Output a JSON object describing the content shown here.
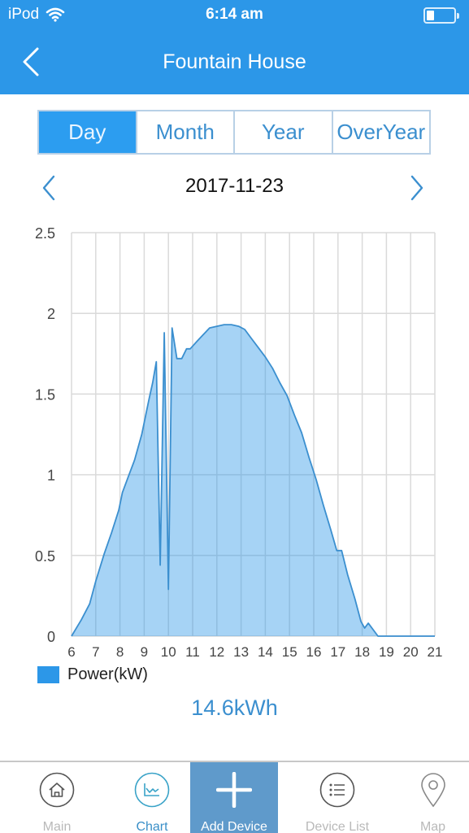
{
  "status_bar": {
    "carrier": "iPod",
    "time": "6:14 am",
    "battery_level": 0.2
  },
  "header": {
    "title": "Fountain House",
    "back_icon": "chevron-left-icon"
  },
  "period_tabs": [
    {
      "label": "Day",
      "active": true
    },
    {
      "label": "Month",
      "active": false
    },
    {
      "label": "Year",
      "active": false
    },
    {
      "label": "OverYear",
      "active": false
    }
  ],
  "date_nav": {
    "date": "2017-11-23",
    "prev_icon": "chevron-left-icon",
    "next_icon": "chevron-right-icon"
  },
  "colors": {
    "accent": "#2c97e8",
    "fill": "#a9d4f5",
    "line": "#3b8fcf",
    "add_tab": "#5f9acb"
  },
  "legend": {
    "label": "Power(kW)"
  },
  "total": {
    "label": "14.6kWh"
  },
  "chart_data": {
    "type": "area",
    "title": "",
    "xlabel": "",
    "ylabel": "",
    "xlim": [
      6,
      21
    ],
    "ylim": [
      0,
      2.5
    ],
    "x_ticks": [
      "6",
      "7",
      "8",
      "9",
      "10",
      "11",
      "12",
      "13",
      "14",
      "15",
      "16",
      "17",
      "18",
      "19",
      "20",
      "21"
    ],
    "y_ticks": [
      "0",
      "0.5",
      "1",
      "1.5",
      "2",
      "2.5"
    ],
    "grid": true,
    "legend_position": "bottom-left",
    "series": [
      {
        "name": "Power(kW)",
        "points": [
          [
            6.0,
            0.0
          ],
          [
            6.4,
            0.1
          ],
          [
            6.75,
            0.2
          ],
          [
            7.0,
            0.34
          ],
          [
            7.35,
            0.51
          ],
          [
            7.65,
            0.64
          ],
          [
            7.95,
            0.78
          ],
          [
            8.1,
            0.89
          ],
          [
            8.35,
            0.99
          ],
          [
            8.6,
            1.09
          ],
          [
            8.9,
            1.25
          ],
          [
            9.2,
            1.47
          ],
          [
            9.35,
            1.57
          ],
          [
            9.5,
            1.7
          ],
          [
            9.66,
            0.44
          ],
          [
            9.83,
            1.88
          ],
          [
            10.0,
            0.29
          ],
          [
            10.15,
            1.91
          ],
          [
            10.35,
            1.72
          ],
          [
            10.55,
            1.72
          ],
          [
            10.75,
            1.78
          ],
          [
            10.9,
            1.78
          ],
          [
            11.2,
            1.83
          ],
          [
            11.45,
            1.87
          ],
          [
            11.7,
            1.91
          ],
          [
            12.0,
            1.92
          ],
          [
            12.3,
            1.93
          ],
          [
            12.6,
            1.93
          ],
          [
            12.9,
            1.92
          ],
          [
            13.15,
            1.9
          ],
          [
            13.4,
            1.85
          ],
          [
            13.7,
            1.79
          ],
          [
            14.0,
            1.73
          ],
          [
            14.3,
            1.66
          ],
          [
            14.6,
            1.57
          ],
          [
            14.9,
            1.49
          ],
          [
            15.2,
            1.37
          ],
          [
            15.5,
            1.26
          ],
          [
            15.8,
            1.11
          ],
          [
            16.1,
            0.97
          ],
          [
            16.4,
            0.81
          ],
          [
            16.7,
            0.66
          ],
          [
            16.95,
            0.53
          ],
          [
            17.15,
            0.53
          ],
          [
            17.4,
            0.38
          ],
          [
            17.7,
            0.23
          ],
          [
            17.95,
            0.09
          ],
          [
            18.1,
            0.05
          ],
          [
            18.25,
            0.08
          ],
          [
            18.65,
            0.0
          ],
          [
            21.0,
            0.0
          ]
        ]
      }
    ]
  },
  "bottom_tabs": [
    {
      "label": "Main",
      "icon": "home-icon",
      "active": false
    },
    {
      "label": "Chart",
      "icon": "chart-icon",
      "active": true
    },
    {
      "label": "Add Device",
      "icon": "plus-icon",
      "active": false
    },
    {
      "label": "Device List",
      "icon": "list-icon",
      "active": false
    },
    {
      "label": "Map",
      "icon": "map-pin-icon",
      "active": false
    }
  ]
}
